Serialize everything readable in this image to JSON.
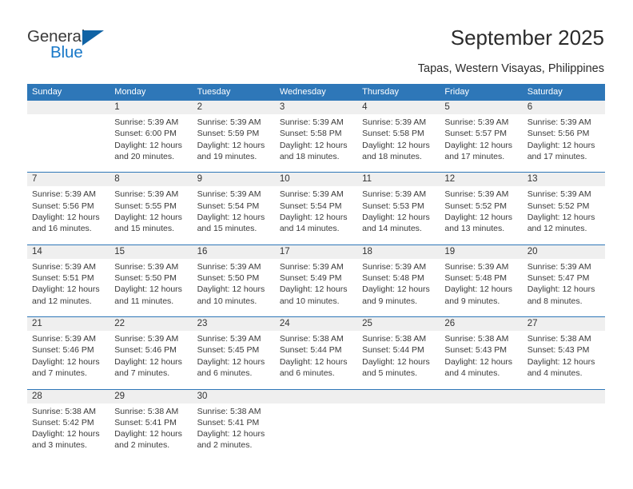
{
  "brand": {
    "name_dark": "General",
    "name_blue": "Blue",
    "color_blue": "#1878c8",
    "color_triangle": "#1063a5"
  },
  "header": {
    "title": "September 2025",
    "subtitle": "Tapas, Western Visayas, Philippines"
  },
  "theme": {
    "header_blue": "#2e77b8",
    "daynum_band": "#efefef",
    "text": "#3a3a3a"
  },
  "calendar": {
    "weekdays": [
      "Sunday",
      "Monday",
      "Tuesday",
      "Wednesday",
      "Thursday",
      "Friday",
      "Saturday"
    ],
    "weeks": [
      [
        {
          "day": "",
          "sunrise": "",
          "sunset": "",
          "daylight": ""
        },
        {
          "day": "1",
          "sunrise": "Sunrise: 5:39 AM",
          "sunset": "Sunset: 6:00 PM",
          "daylight": "Daylight: 12 hours and 20 minutes."
        },
        {
          "day": "2",
          "sunrise": "Sunrise: 5:39 AM",
          "sunset": "Sunset: 5:59 PM",
          "daylight": "Daylight: 12 hours and 19 minutes."
        },
        {
          "day": "3",
          "sunrise": "Sunrise: 5:39 AM",
          "sunset": "Sunset: 5:58 PM",
          "daylight": "Daylight: 12 hours and 18 minutes."
        },
        {
          "day": "4",
          "sunrise": "Sunrise: 5:39 AM",
          "sunset": "Sunset: 5:58 PM",
          "daylight": "Daylight: 12 hours and 18 minutes."
        },
        {
          "day": "5",
          "sunrise": "Sunrise: 5:39 AM",
          "sunset": "Sunset: 5:57 PM",
          "daylight": "Daylight: 12 hours and 17 minutes."
        },
        {
          "day": "6",
          "sunrise": "Sunrise: 5:39 AM",
          "sunset": "Sunset: 5:56 PM",
          "daylight": "Daylight: 12 hours and 17 minutes."
        }
      ],
      [
        {
          "day": "7",
          "sunrise": "Sunrise: 5:39 AM",
          "sunset": "Sunset: 5:56 PM",
          "daylight": "Daylight: 12 hours and 16 minutes."
        },
        {
          "day": "8",
          "sunrise": "Sunrise: 5:39 AM",
          "sunset": "Sunset: 5:55 PM",
          "daylight": "Daylight: 12 hours and 15 minutes."
        },
        {
          "day": "9",
          "sunrise": "Sunrise: 5:39 AM",
          "sunset": "Sunset: 5:54 PM",
          "daylight": "Daylight: 12 hours and 15 minutes."
        },
        {
          "day": "10",
          "sunrise": "Sunrise: 5:39 AM",
          "sunset": "Sunset: 5:54 PM",
          "daylight": "Daylight: 12 hours and 14 minutes."
        },
        {
          "day": "11",
          "sunrise": "Sunrise: 5:39 AM",
          "sunset": "Sunset: 5:53 PM",
          "daylight": "Daylight: 12 hours and 14 minutes."
        },
        {
          "day": "12",
          "sunrise": "Sunrise: 5:39 AM",
          "sunset": "Sunset: 5:52 PM",
          "daylight": "Daylight: 12 hours and 13 minutes."
        },
        {
          "day": "13",
          "sunrise": "Sunrise: 5:39 AM",
          "sunset": "Sunset: 5:52 PM",
          "daylight": "Daylight: 12 hours and 12 minutes."
        }
      ],
      [
        {
          "day": "14",
          "sunrise": "Sunrise: 5:39 AM",
          "sunset": "Sunset: 5:51 PM",
          "daylight": "Daylight: 12 hours and 12 minutes."
        },
        {
          "day": "15",
          "sunrise": "Sunrise: 5:39 AM",
          "sunset": "Sunset: 5:50 PM",
          "daylight": "Daylight: 12 hours and 11 minutes."
        },
        {
          "day": "16",
          "sunrise": "Sunrise: 5:39 AM",
          "sunset": "Sunset: 5:50 PM",
          "daylight": "Daylight: 12 hours and 10 minutes."
        },
        {
          "day": "17",
          "sunrise": "Sunrise: 5:39 AM",
          "sunset": "Sunset: 5:49 PM",
          "daylight": "Daylight: 12 hours and 10 minutes."
        },
        {
          "day": "18",
          "sunrise": "Sunrise: 5:39 AM",
          "sunset": "Sunset: 5:48 PM",
          "daylight": "Daylight: 12 hours and 9 minutes."
        },
        {
          "day": "19",
          "sunrise": "Sunrise: 5:39 AM",
          "sunset": "Sunset: 5:48 PM",
          "daylight": "Daylight: 12 hours and 9 minutes."
        },
        {
          "day": "20",
          "sunrise": "Sunrise: 5:39 AM",
          "sunset": "Sunset: 5:47 PM",
          "daylight": "Daylight: 12 hours and 8 minutes."
        }
      ],
      [
        {
          "day": "21",
          "sunrise": "Sunrise: 5:39 AM",
          "sunset": "Sunset: 5:46 PM",
          "daylight": "Daylight: 12 hours and 7 minutes."
        },
        {
          "day": "22",
          "sunrise": "Sunrise: 5:39 AM",
          "sunset": "Sunset: 5:46 PM",
          "daylight": "Daylight: 12 hours and 7 minutes."
        },
        {
          "day": "23",
          "sunrise": "Sunrise: 5:39 AM",
          "sunset": "Sunset: 5:45 PM",
          "daylight": "Daylight: 12 hours and 6 minutes."
        },
        {
          "day": "24",
          "sunrise": "Sunrise: 5:38 AM",
          "sunset": "Sunset: 5:44 PM",
          "daylight": "Daylight: 12 hours and 6 minutes."
        },
        {
          "day": "25",
          "sunrise": "Sunrise: 5:38 AM",
          "sunset": "Sunset: 5:44 PM",
          "daylight": "Daylight: 12 hours and 5 minutes."
        },
        {
          "day": "26",
          "sunrise": "Sunrise: 5:38 AM",
          "sunset": "Sunset: 5:43 PM",
          "daylight": "Daylight: 12 hours and 4 minutes."
        },
        {
          "day": "27",
          "sunrise": "Sunrise: 5:38 AM",
          "sunset": "Sunset: 5:43 PM",
          "daylight": "Daylight: 12 hours and 4 minutes."
        }
      ],
      [
        {
          "day": "28",
          "sunrise": "Sunrise: 5:38 AM",
          "sunset": "Sunset: 5:42 PM",
          "daylight": "Daylight: 12 hours and 3 minutes."
        },
        {
          "day": "29",
          "sunrise": "Sunrise: 5:38 AM",
          "sunset": "Sunset: 5:41 PM",
          "daylight": "Daylight: 12 hours and 2 minutes."
        },
        {
          "day": "30",
          "sunrise": "Sunrise: 5:38 AM",
          "sunset": "Sunset: 5:41 PM",
          "daylight": "Daylight: 12 hours and 2 minutes."
        },
        {
          "day": "",
          "sunrise": "",
          "sunset": "",
          "daylight": ""
        },
        {
          "day": "",
          "sunrise": "",
          "sunset": "",
          "daylight": ""
        },
        {
          "day": "",
          "sunrise": "",
          "sunset": "",
          "daylight": ""
        },
        {
          "day": "",
          "sunrise": "",
          "sunset": "",
          "daylight": ""
        }
      ]
    ]
  }
}
